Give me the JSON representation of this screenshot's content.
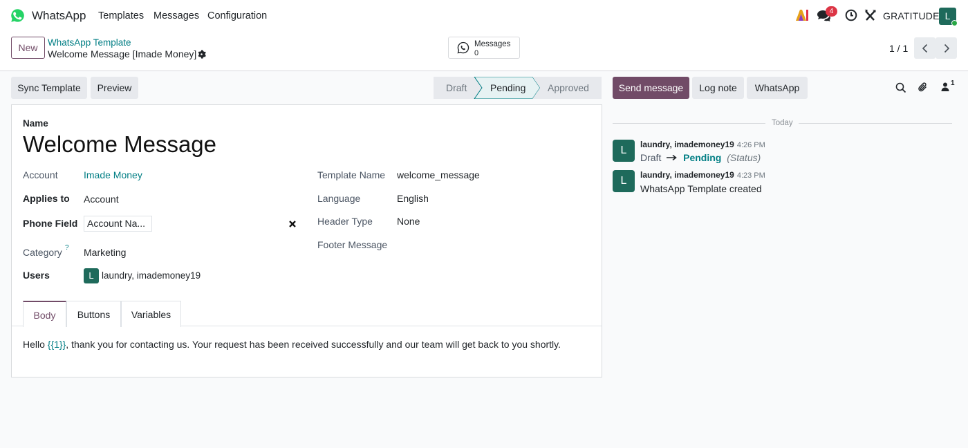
{
  "navbar": {
    "app_name": "WhatsApp",
    "menu": [
      "Templates",
      "Messages",
      "Configuration"
    ],
    "chat_badge": "4",
    "company": "GRATITUDE",
    "user_initial": "L"
  },
  "control": {
    "new_label": "New",
    "breadcrumb_parent": "WhatsApp Template",
    "breadcrumb_current": "Welcome Message [Imade Money]",
    "messages_label": "Messages",
    "messages_count": "0",
    "pager": "1 / 1"
  },
  "actions": {
    "sync_template": "Sync Template",
    "preview": "Preview"
  },
  "status": {
    "stages": [
      "Draft",
      "Pending",
      "Approved"
    ],
    "current": "Pending"
  },
  "form": {
    "name_label": "Name",
    "name_value": "Welcome Message",
    "account_label": "Account",
    "account_value": "Imade Money",
    "applies_to_label": "Applies to",
    "applies_to_value": "Account",
    "phone_field_label": "Phone Field",
    "phone_field_value": "Account Na...",
    "category_label": "Category",
    "category_help": "?",
    "category_value": "Marketing",
    "users_label": "Users",
    "users_initial": "L",
    "users_value": "laundry, imademoney19",
    "template_name_label": "Template Name",
    "template_name_value": "welcome_message",
    "language_label": "Language",
    "language_value": "English",
    "header_type_label": "Header Type",
    "header_type_value": "None",
    "footer_message_label": "Footer Message"
  },
  "tabs": [
    "Body",
    "Buttons",
    "Variables"
  ],
  "body": {
    "prefix": "Hello ",
    "variable": "{{1}}",
    "suffix": ", thank you for contacting us. Your request has been received successfully and our team will get back to you shortly."
  },
  "chatter": {
    "send_message": "Send message",
    "log_note": "Log note",
    "whatsapp": "WhatsApp",
    "followers_count": "1",
    "today": "Today",
    "messages": [
      {
        "author": "laundry, imademoney19",
        "time": "4:26 PM",
        "initial": "L",
        "from": "Draft",
        "to": "Pending",
        "field": "(Status)"
      },
      {
        "author": "laundry, imademoney19",
        "time": "4:23 PM",
        "initial": "L",
        "body": "WhatsApp Template created"
      }
    ]
  },
  "colors": {
    "brand": "#714b67",
    "link": "#017e84",
    "avatar": "#1e6a5b",
    "whatsapp_green": "#25d366"
  }
}
